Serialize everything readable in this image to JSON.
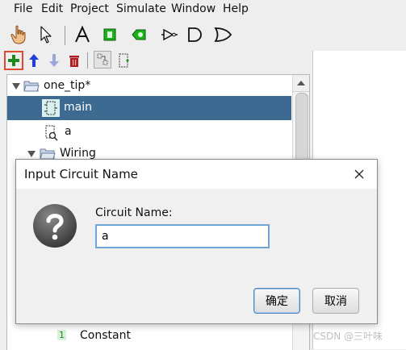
{
  "menubar": {
    "items": [
      "File",
      "Edit",
      "Project",
      "Simulate",
      "Window",
      "Help"
    ]
  },
  "tree": {
    "project": "one_tip*",
    "circuits": [
      "main",
      "a"
    ],
    "folder": "Wiring",
    "constant": "Constant",
    "constant_badge": "1"
  },
  "dialog": {
    "title": "Input Circuit Name",
    "label": "Circuit Name:",
    "value": "a",
    "ok": "确定",
    "cancel": "取消"
  },
  "watermark": "CSDN @三叶味",
  "colors": {
    "selection": "#3d6a90",
    "add_highlight": "#e0492f",
    "input_focus": "#6fa6d6"
  }
}
